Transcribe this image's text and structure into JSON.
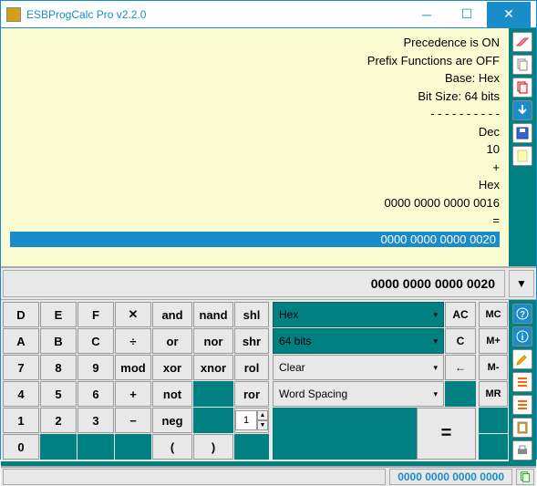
{
  "window": {
    "title": "ESBProgCalc Pro v2.2.0"
  },
  "history": {
    "lines": [
      "Precedence is ON",
      "Prefix Functions are OFF",
      "Base: Hex",
      "Bit Size: 64 bits",
      "- - - - - - - - - -",
      "Dec",
      "10",
      "+",
      "Hex",
      "0000 0000 0000 0016",
      "="
    ],
    "current": "0000 0000 0000 0020"
  },
  "display": {
    "value": "0000 0000 0000 0020"
  },
  "keys": {
    "r0": [
      "D",
      "E",
      "F",
      "✕",
      "and",
      "nand",
      "shl"
    ],
    "r1": [
      "A",
      "B",
      "C",
      "÷",
      "or",
      "nor",
      "shr"
    ],
    "r2": [
      "7",
      "8",
      "9",
      "mod",
      "xor",
      "xnor",
      "rol"
    ],
    "r3": [
      "4",
      "5",
      "6",
      "+",
      "not",
      "",
      "ror"
    ],
    "r4": [
      "1",
      "2",
      "3",
      "−",
      "neg",
      "",
      "spin"
    ],
    "r5": [
      "0",
      "",
      "",
      "",
      "(",
      ")",
      ""
    ],
    "spin_val": "1"
  },
  "combos": {
    "base": "Hex",
    "bits": "64 bits",
    "clear": "Clear",
    "spacing": "Word Spacing"
  },
  "small": {
    "ac": "AC",
    "c": "C",
    "back": "←",
    "eq": "="
  },
  "mem": {
    "mc": "MC",
    "mp": "M+",
    "mm": "M-",
    "mr": "MR"
  },
  "status": {
    "bin": "0000 0000 0000 0000"
  }
}
